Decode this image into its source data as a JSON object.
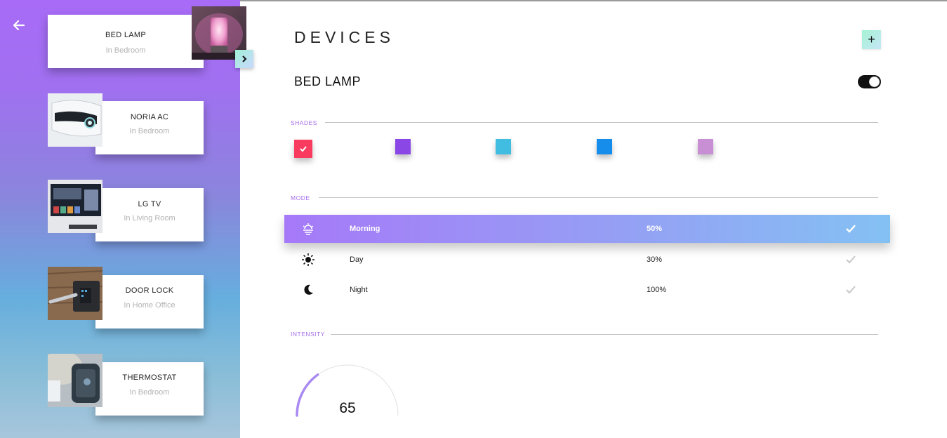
{
  "page": {
    "title": "DEVICES",
    "add_label": "+"
  },
  "devices": [
    {
      "name": "BED LAMP",
      "room": "In Bedroom",
      "photo": "lamp-photo"
    },
    {
      "name": "NORIA AC",
      "room": "In Bedroom",
      "photo": "ac-photo"
    },
    {
      "name": "LG TV",
      "room": "In Living Room",
      "photo": "tv-photo"
    },
    {
      "name": "DOOR LOCK",
      "room": "In Home Office",
      "photo": "door-lock-photo"
    },
    {
      "name": "THERMOSTAT",
      "room": "In Bedroom",
      "photo": "thermostat-photo"
    }
  ],
  "selected_device": {
    "name": "BED LAMP",
    "power_on": true
  },
  "shades": {
    "label": "SHADES",
    "colors": [
      "#f83b5f",
      "#8a47e6",
      "#40bde0",
      "#168ceb",
      "#c88fd4"
    ],
    "selected_index": 0
  },
  "mode": {
    "label": "MODE",
    "rows": [
      {
        "icon": "sunrise-icon",
        "name": "Morning",
        "percent": "50%",
        "active": true
      },
      {
        "icon": "sun-icon",
        "name": "Day",
        "percent": "30%",
        "active": false
      },
      {
        "icon": "moon-icon",
        "name": "Night",
        "percent": "100%",
        "active": false
      }
    ]
  },
  "intensity": {
    "label": "INTENSITY",
    "value": "65",
    "level": 0.65
  },
  "colors": {
    "accent": "#a66de8",
    "sidebar_top": "#a86bf7",
    "sidebar_bottom": "#a7c6dc",
    "gauge": "#a98af2"
  }
}
